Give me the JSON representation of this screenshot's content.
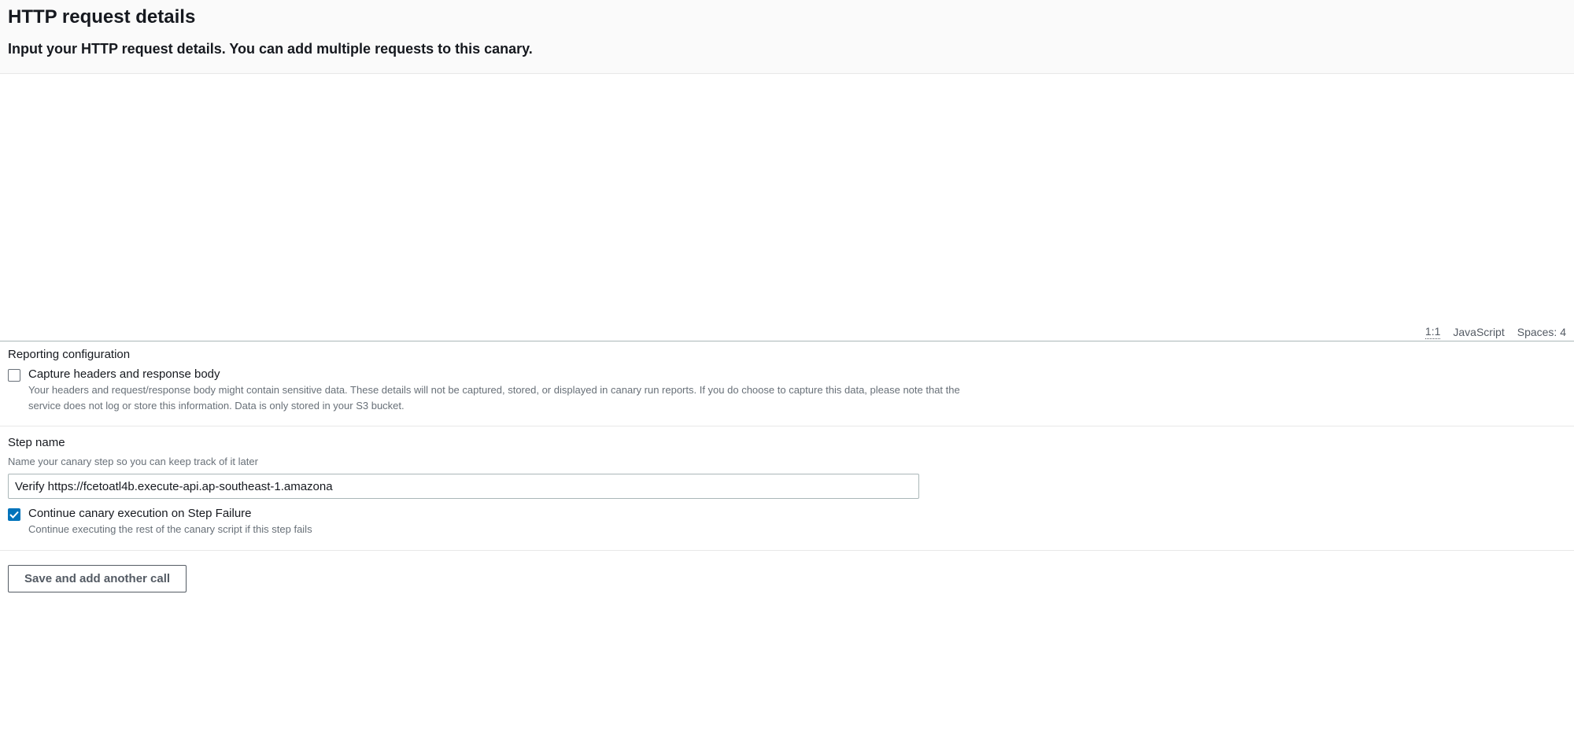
{
  "header": {
    "title": "HTTP request details",
    "subtitle": "Input your HTTP request details. You can add multiple requests to this canary."
  },
  "editor": {
    "cursor": "1:1",
    "language": "JavaScript",
    "spaces": "Spaces: 4"
  },
  "reporting": {
    "section_label": "Reporting configuration",
    "capture_label": "Capture headers and response body",
    "capture_description": "Your headers and request/response body might contain sensitive data. These details will not be captured, stored, or displayed in canary run reports. If you do choose to capture this data, please note that the service does not log or store this information. Data is only stored in your S3 bucket."
  },
  "step": {
    "label": "Step name",
    "helper": "Name your canary step so you can keep track of it later",
    "value": "Verify https://fcetoatl4b.execute-api.ap-southeast-1.amazona",
    "continue_label": "Continue canary execution on Step Failure",
    "continue_description": "Continue executing the rest of the canary script if this step fails"
  },
  "buttons": {
    "save_add": "Save and add another call"
  }
}
